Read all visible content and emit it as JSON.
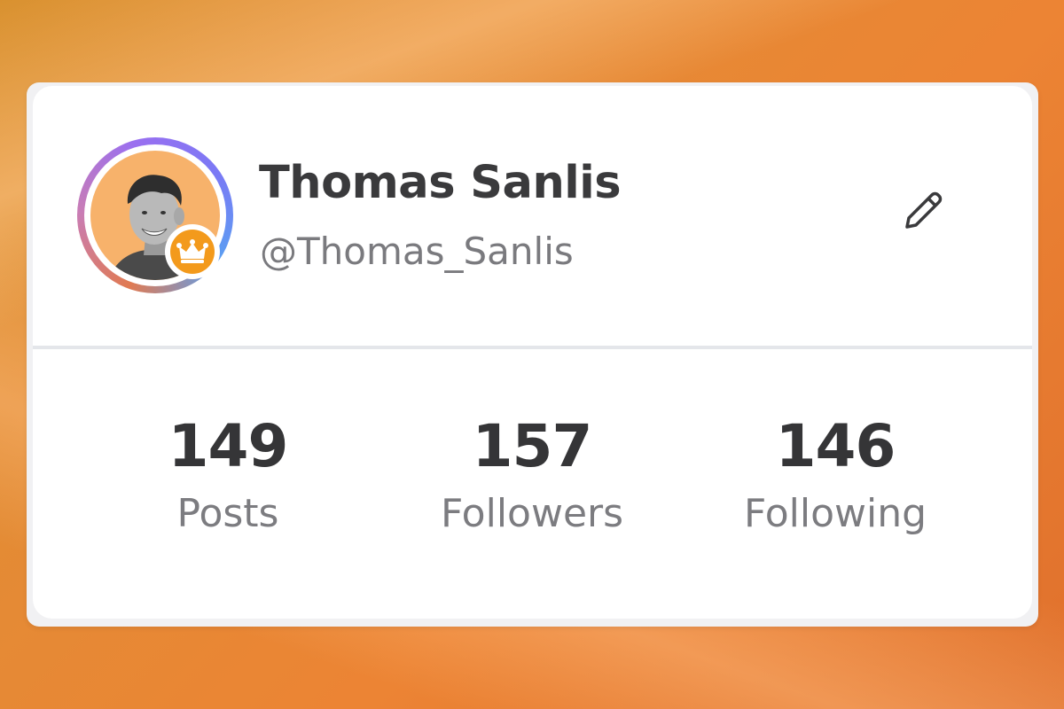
{
  "profile": {
    "name": "Thomas Sanlis",
    "handle": "@Thomas_Sanlis",
    "avatar_icon": "user-photo",
    "badge_icon": "crown-icon",
    "badge_color": "#f39a1c",
    "edit_icon": "pencil-icon"
  },
  "stats": [
    {
      "value": "149",
      "label": "Posts"
    },
    {
      "value": "157",
      "label": "Followers"
    },
    {
      "value": "146",
      "label": "Following"
    }
  ],
  "colors": {
    "card_background": "#ffffff",
    "ring_gradient": [
      "#e07a52",
      "#9a6ff0",
      "#5aa0f2"
    ],
    "avatar_background": "#f7b26b",
    "text_primary": "#3a3a3c",
    "text_secondary": "#7a7a7e"
  }
}
